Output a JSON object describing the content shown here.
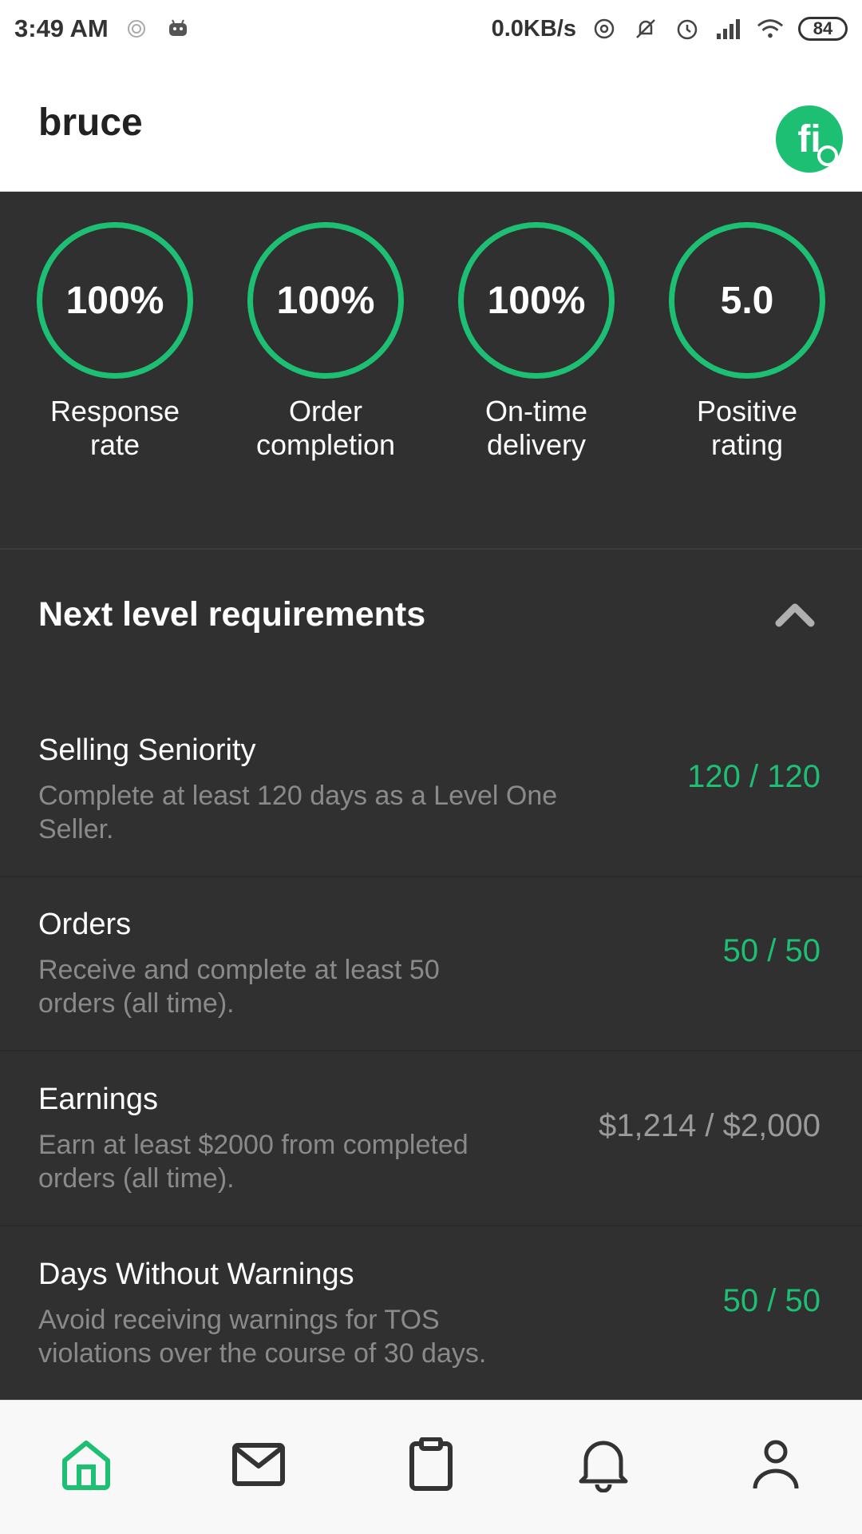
{
  "status_bar": {
    "time": "3:49 AM",
    "speed": "0.0KB/s",
    "battery": "84",
    "icons": [
      "hotspot-icon",
      "android-icon",
      "data-sync-icon",
      "mute-icon",
      "alarm-icon",
      "signal-icon",
      "wifi-icon",
      "battery-icon"
    ]
  },
  "header": {
    "title": "bruce",
    "avatar_initials": "fi"
  },
  "stats": [
    {
      "value": "100%",
      "label_line1": "Response",
      "label_line2": "rate"
    },
    {
      "value": "100%",
      "label_line1": "Order",
      "label_line2": "completion"
    },
    {
      "value": "100%",
      "label_line1": "On-time",
      "label_line2": "delivery"
    },
    {
      "value": "5.0",
      "label_line1": "Positive",
      "label_line2": "rating"
    }
  ],
  "next_level": {
    "heading": "Next level requirements",
    "requirements": [
      {
        "title": "Selling Seniority",
        "desc_line1": "Complete at least 120 days as a Level One",
        "desc_line2": "Seller.",
        "progress": "120 / 120",
        "met": true
      },
      {
        "title": "Orders",
        "desc_line1": "Receive and complete at least 50",
        "desc_line2": "orders (all time).",
        "progress": "50 / 50",
        "met": true
      },
      {
        "title": "Earnings",
        "desc_line1": "Earn at least $2000 from completed",
        "desc_line2": "orders (all time).",
        "progress": "$1,214 / $2,000",
        "met": false
      },
      {
        "title": "Days Without Warnings",
        "desc_line1": "Avoid receiving warnings for TOS",
        "desc_line2": "violations over the course of 30 days.",
        "progress": "50 / 50",
        "met": true
      }
    ]
  },
  "bottom_nav": {
    "items": [
      "home-icon",
      "inbox-icon",
      "orders-icon",
      "notifications-icon",
      "profile-icon"
    ],
    "active": "home-icon"
  },
  "colors": {
    "accent": "#1dbf73",
    "background_dark": "#303030",
    "muted_text": "#8a8a8a"
  }
}
